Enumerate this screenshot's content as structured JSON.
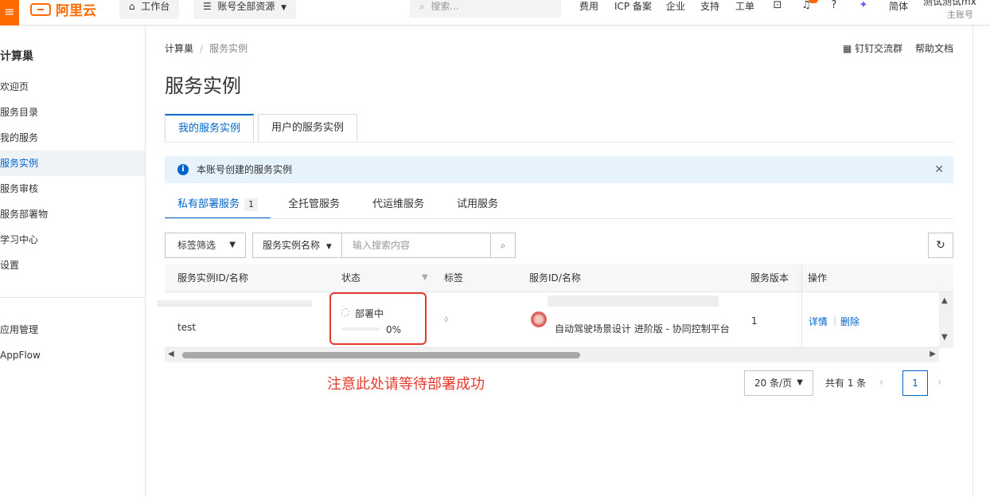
{
  "topbar": {
    "logo_text": "阿里云",
    "workbench": "工作台",
    "resources": "账号全部资源",
    "search_placeholder": "搜索...",
    "links": [
      "费用",
      "ICP 备案",
      "企业",
      "支持",
      "工单"
    ],
    "lang": "简体",
    "account_name": "测试测试mx",
    "account_role": "主账号",
    "accent": "#ff6a00"
  },
  "sidebar": {
    "title": "计算巢",
    "items": [
      "欢迎页",
      "服务目录",
      "我的服务",
      "服务实例",
      "服务审核",
      "服务部署物",
      "学习中心",
      "设置"
    ],
    "active": "服务实例",
    "extra_items": [
      "应用管理",
      "AppFlow"
    ]
  },
  "breadcrumb": {
    "root": "计算巢",
    "current": "服务实例"
  },
  "help": {
    "dingtalk": "钉钉交流群",
    "docs": "帮助文档"
  },
  "page_title": "服务实例",
  "tabs": [
    "我的服务实例",
    "用户的服务实例"
  ],
  "notice": {
    "text": "本账号创建的服务实例",
    "icon": "info-icon"
  },
  "subtabs": [
    {
      "label": "私有部署服务",
      "count": "1"
    },
    {
      "label": "全托管服务"
    },
    {
      "label": "代运维服务"
    },
    {
      "label": "试用服务"
    }
  ],
  "filters": {
    "tag_filter": "标签筛选",
    "search_field": "服务实例名称",
    "search_placeholder": "输入搜索内容"
  },
  "table": {
    "columns": [
      "服务实例ID/名称",
      "状态",
      "标签",
      "服务ID/名称",
      "服务版本",
      "操作"
    ],
    "rows": [
      {
        "name": "test",
        "status": "部署中",
        "progress_label": "0%",
        "progress": 0,
        "service_name": "自动驾驶场景设计 进阶版 - 协同控制平台",
        "version": "1",
        "actions": [
          "详情",
          "删除"
        ]
      }
    ]
  },
  "annotation": "注意此处请等待部署成功",
  "pagination": {
    "page_size": "20 条/页",
    "total": "共有 1 条",
    "current": "1"
  },
  "colors": {
    "primary": "#0064c8",
    "annotation": "#e5392b"
  }
}
